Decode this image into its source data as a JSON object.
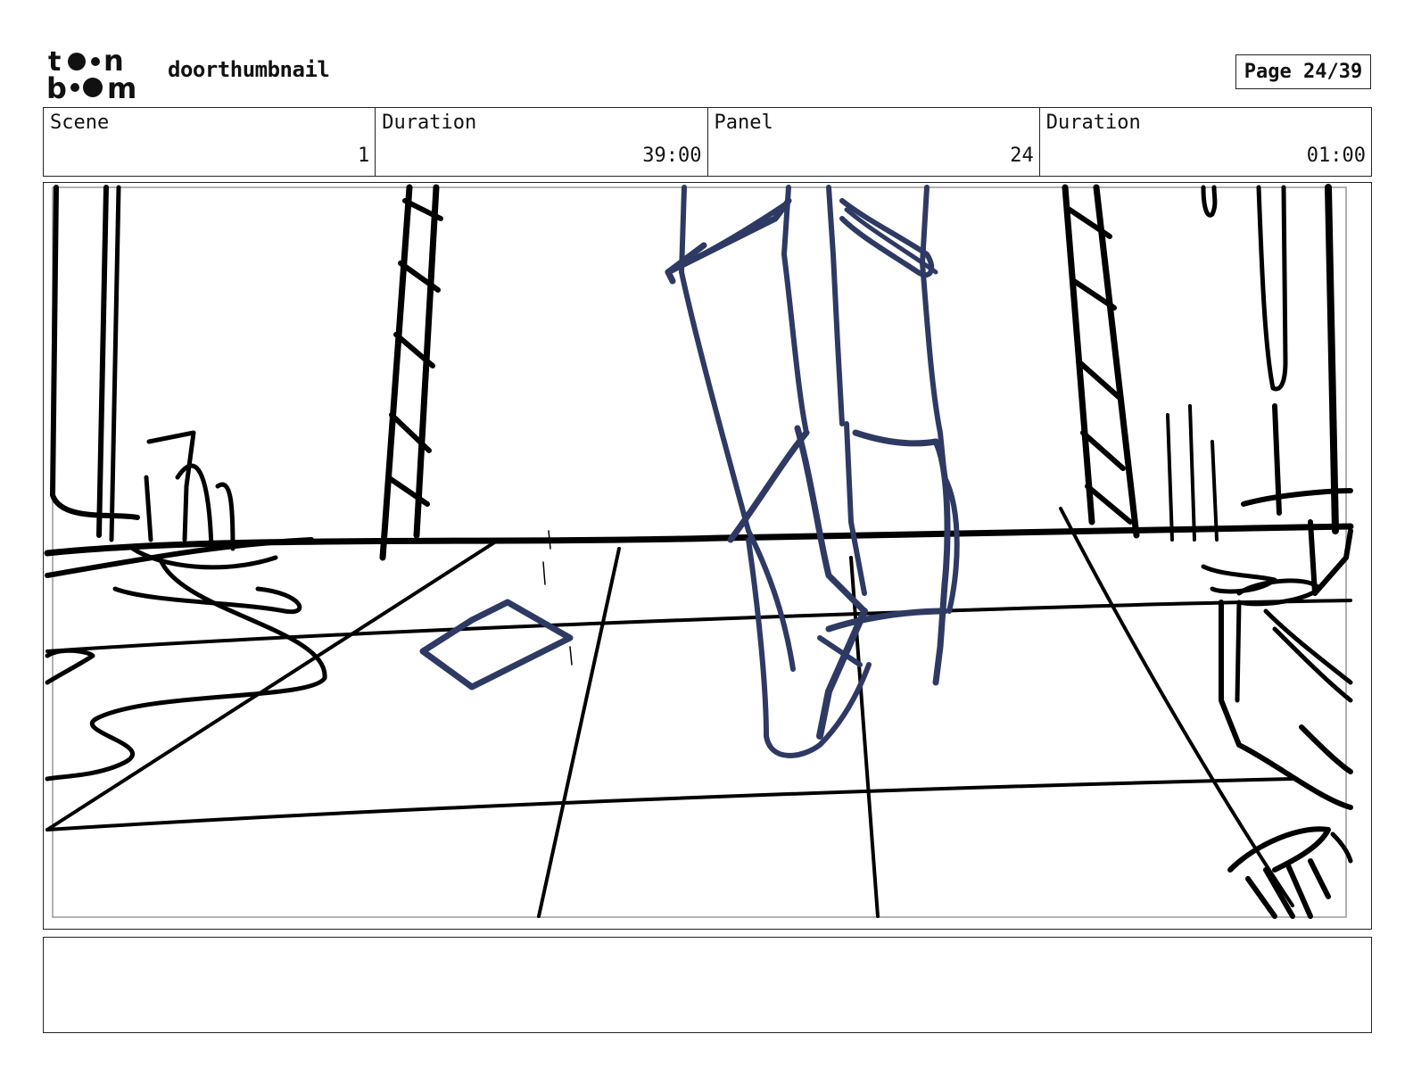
{
  "header": {
    "logo_icon": "toonboom-logo-icon",
    "project_title": "doorthumbnail",
    "page_indicator": "Page 24/39"
  },
  "info_row": {
    "scene": {
      "label": "Scene",
      "value": "1"
    },
    "scene_duration": {
      "label": "Duration",
      "value": "39:00"
    },
    "panel": {
      "label": "Panel",
      "value": "24"
    },
    "panel_duration": {
      "label": "Duration",
      "value": "01:00"
    }
  },
  "panel_image": {
    "description_icon": "storyboard-sketch-icon",
    "ink_color": "#000000",
    "character_color": "#2e3a63"
  },
  "notes": {
    "text": ""
  }
}
